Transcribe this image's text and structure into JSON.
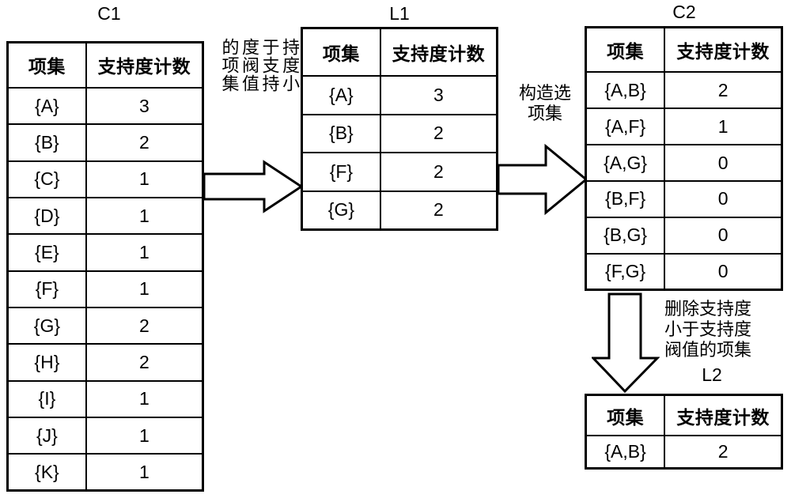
{
  "diagram": {
    "title_c1": "C1",
    "title_l1": "L1",
    "title_c2": "C2",
    "title_l2": "L2",
    "headers": {
      "itemset": "项集",
      "support_count": "支持度计数"
    },
    "tables": {
      "c1": {
        "label": "C1",
        "columns": [
          "项集",
          "支持度计数"
        ],
        "rows": [
          {
            "itemset": "{A}",
            "count": "3"
          },
          {
            "itemset": "{B}",
            "count": "2"
          },
          {
            "itemset": "{C}",
            "count": "1"
          },
          {
            "itemset": "{D}",
            "count": "1"
          },
          {
            "itemset": "{E}",
            "count": "1"
          },
          {
            "itemset": "{F}",
            "count": "1"
          },
          {
            "itemset": "{G}",
            "count": "2"
          },
          {
            "itemset": "{H}",
            "count": "2"
          },
          {
            "itemset": "{I}",
            "count": "1"
          },
          {
            "itemset": "{J}",
            "count": "1"
          },
          {
            "itemset": "{K}",
            "count": "1"
          }
        ]
      },
      "l1": {
        "label": "L1",
        "columns": [
          "项集",
          "支持度计数"
        ],
        "rows": [
          {
            "itemset": "{A}",
            "count": "3"
          },
          {
            "itemset": "{B}",
            "count": "2"
          },
          {
            "itemset": "{F}",
            "count": "2"
          },
          {
            "itemset": "{G}",
            "count": "2"
          }
        ]
      },
      "c2": {
        "label": "C2",
        "columns": [
          "项集",
          "支持度计数"
        ],
        "rows": [
          {
            "itemset": "{A,B}",
            "count": "2"
          },
          {
            "itemset": "{A,F}",
            "count": "1"
          },
          {
            "itemset": "{A,G}",
            "count": "0"
          },
          {
            "itemset": "{B,F}",
            "count": "0"
          },
          {
            "itemset": "{B,G}",
            "count": "0"
          },
          {
            "itemset": "{F,G}",
            "count": "0"
          }
        ]
      },
      "l2": {
        "label": "L2",
        "columns": [
          "项集",
          "支持度计数"
        ],
        "rows": [
          {
            "itemset": "{A,B}",
            "count": "2"
          }
        ]
      }
    },
    "annotations": {
      "prune_c1_to_l1": "删除支\n持度小\n于支持\n度阀值\n的项集",
      "build_candidates": "构造选\n项集",
      "prune_c2_to_l2": "删除支持度\n小于支持度\n阀值的项集"
    },
    "arrows": {
      "c1_to_l1": "right-arrow-icon",
      "l1_to_c2": "right-arrow-icon",
      "c2_to_l2": "down-arrow-icon"
    },
    "colors": {
      "line": "#000000",
      "background": "#ffffff",
      "fill": "#ffffff"
    }
  }
}
